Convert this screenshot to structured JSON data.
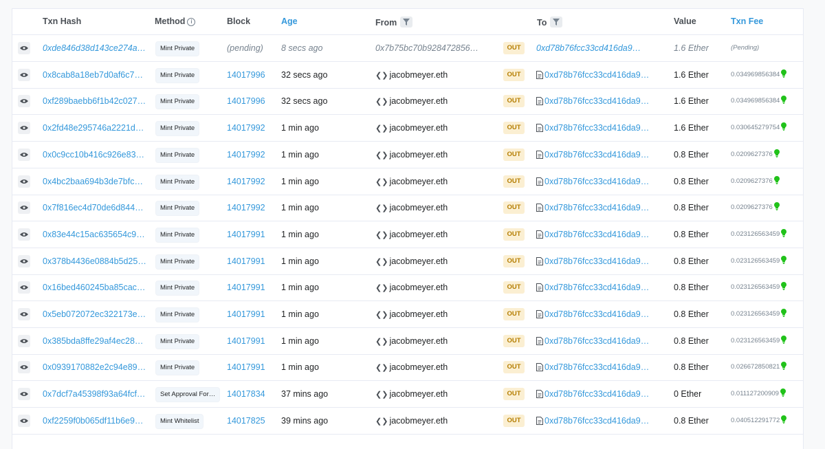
{
  "headers": {
    "txn_hash": "Txn Hash",
    "method": "Method",
    "block": "Block",
    "age": "Age",
    "from": "From",
    "to": "To",
    "value": "Value",
    "txn_fee": "Txn Fee"
  },
  "colors": {
    "link": "#3498db",
    "out_bg": "#fbefd2",
    "out_text": "#b47d00",
    "bulb": "#21c21a"
  },
  "rows": [
    {
      "hash": "0xde846d38d143ce274a…",
      "method": "Mint Private",
      "block": "(pending)",
      "age": "8 secs ago",
      "from": "0x7b75bc70b928472856…",
      "direction": "OUT",
      "to": "0xd78b76fcc33cd416da9…",
      "value": "1.6 Ether",
      "fee": "(Pending)"
    },
    {
      "hash": "0x8cab8a18eb7d0af6c7…",
      "method": "Mint Private",
      "block": "14017996",
      "age": "32 secs ago",
      "from": "jacobmeyer.eth",
      "direction": "OUT",
      "to": "0xd78b76fcc33cd416da9…",
      "value": "1.6 Ether",
      "fee": "0.034969856384"
    },
    {
      "hash": "0xf289baebb6f1b42c027…",
      "method": "Mint Private",
      "block": "14017996",
      "age": "32 secs ago",
      "from": "jacobmeyer.eth",
      "direction": "OUT",
      "to": "0xd78b76fcc33cd416da9…",
      "value": "1.6 Ether",
      "fee": "0.034969856384"
    },
    {
      "hash": "0x2fd48e295746a2221d…",
      "method": "Mint Private",
      "block": "14017992",
      "age": "1 min ago",
      "from": "jacobmeyer.eth",
      "direction": "OUT",
      "to": "0xd78b76fcc33cd416da9…",
      "value": "1.6 Ether",
      "fee": "0.030645279754"
    },
    {
      "hash": "0x0c9cc10b416c926e83…",
      "method": "Mint Private",
      "block": "14017992",
      "age": "1 min ago",
      "from": "jacobmeyer.eth",
      "direction": "OUT",
      "to": "0xd78b76fcc33cd416da9…",
      "value": "0.8 Ether",
      "fee": "0.0209627376"
    },
    {
      "hash": "0x4bc2baa694b3de7bfc…",
      "method": "Mint Private",
      "block": "14017992",
      "age": "1 min ago",
      "from": "jacobmeyer.eth",
      "direction": "OUT",
      "to": "0xd78b76fcc33cd416da9…",
      "value": "0.8 Ether",
      "fee": "0.0209627376"
    },
    {
      "hash": "0x7f816ec4d70de6d844…",
      "method": "Mint Private",
      "block": "14017992",
      "age": "1 min ago",
      "from": "jacobmeyer.eth",
      "direction": "OUT",
      "to": "0xd78b76fcc33cd416da9…",
      "value": "0.8 Ether",
      "fee": "0.0209627376"
    },
    {
      "hash": "0x83e44c15ac635654c9…",
      "method": "Mint Private",
      "block": "14017991",
      "age": "1 min ago",
      "from": "jacobmeyer.eth",
      "direction": "OUT",
      "to": "0xd78b76fcc33cd416da9…",
      "value": "0.8 Ether",
      "fee": "0.023126563459"
    },
    {
      "hash": "0x378b4436e0884b5d25…",
      "method": "Mint Private",
      "block": "14017991",
      "age": "1 min ago",
      "from": "jacobmeyer.eth",
      "direction": "OUT",
      "to": "0xd78b76fcc33cd416da9…",
      "value": "0.8 Ether",
      "fee": "0.023126563459"
    },
    {
      "hash": "0x16bed460245ba85cac…",
      "method": "Mint Private",
      "block": "14017991",
      "age": "1 min ago",
      "from": "jacobmeyer.eth",
      "direction": "OUT",
      "to": "0xd78b76fcc33cd416da9…",
      "value": "0.8 Ether",
      "fee": "0.023126563459"
    },
    {
      "hash": "0x5eb072072ec322173e…",
      "method": "Mint Private",
      "block": "14017991",
      "age": "1 min ago",
      "from": "jacobmeyer.eth",
      "direction": "OUT",
      "to": "0xd78b76fcc33cd416da9…",
      "value": "0.8 Ether",
      "fee": "0.023126563459"
    },
    {
      "hash": "0x385bda8ffe29af4ec28…",
      "method": "Mint Private",
      "block": "14017991",
      "age": "1 min ago",
      "from": "jacobmeyer.eth",
      "direction": "OUT",
      "to": "0xd78b76fcc33cd416da9…",
      "value": "0.8 Ether",
      "fee": "0.023126563459"
    },
    {
      "hash": "0x0939170882e2c94e89…",
      "method": "Mint Private",
      "block": "14017991",
      "age": "1 min ago",
      "from": "jacobmeyer.eth",
      "direction": "OUT",
      "to": "0xd78b76fcc33cd416da9…",
      "value": "0.8 Ether",
      "fee": "0.026672850821"
    },
    {
      "hash": "0x7dcf7a45398f93a64fcf…",
      "method": "Set Approval For…",
      "block": "14017834",
      "age": "37 mins ago",
      "from": "jacobmeyer.eth",
      "direction": "OUT",
      "to": "0xd78b76fcc33cd416da9…",
      "value": "0 Ether",
      "fee": "0.011127200909"
    },
    {
      "hash": "0xf2259f0b065df11b6e9…",
      "method": "Mint Whitelist",
      "block": "14017825",
      "age": "39 mins ago",
      "from": "jacobmeyer.eth",
      "direction": "OUT",
      "to": "0xd78b76fcc33cd416da9…",
      "value": "0.8 Ether",
      "fee": "0.040512291772"
    }
  ]
}
